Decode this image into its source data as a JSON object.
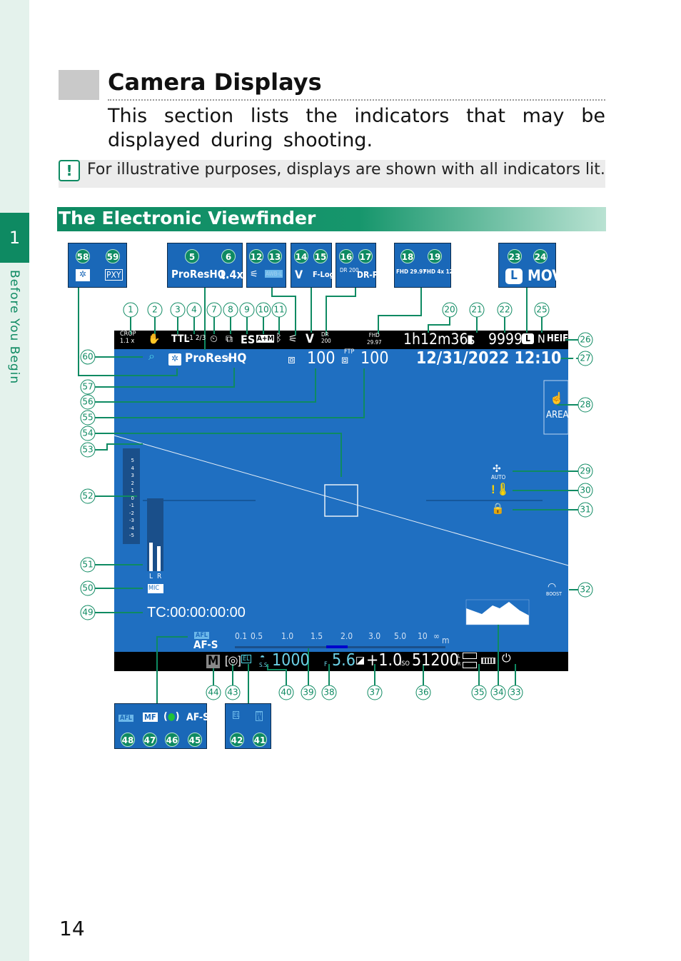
{
  "sidebar": {
    "chapter": "1",
    "label": "Before You Begin"
  },
  "page": {
    "title": "Camera Displays",
    "intro": "This section lists the indicators that may be displayed during shooting.",
    "note": "For illustrative purposes, displays are shown with all indicators lit.",
    "note_icon": "caution-icon",
    "section": "The Electronic Viewfinder",
    "number": "14"
  },
  "boxes": {
    "a": {
      "nums": [
        "58",
        "59"
      ],
      "items": [
        "shutter-icon",
        "PXY"
      ]
    },
    "b": {
      "nums": [
        "5",
        "6"
      ],
      "items": [
        "ProResHQ",
        "1.4x"
      ]
    },
    "c": {
      "nums": [
        "12",
        "13"
      ],
      "items": [
        "flicker-icon",
        "AWB-L"
      ]
    },
    "d": {
      "nums": [
        "14",
        "15"
      ],
      "items": [
        "V",
        "F-Log"
      ]
    },
    "e": {
      "nums": [
        "16",
        "17"
      ],
      "items": [
        "DR 200",
        "DR-P"
      ]
    },
    "f": {
      "nums": [
        "18",
        "19"
      ],
      "items": [
        "FHD 29.97",
        "FHD 4x 120"
      ]
    },
    "g": {
      "nums": [
        "23",
        "24"
      ],
      "items": [
        "L",
        "MOV"
      ]
    },
    "h": {
      "nums": [
        "48",
        "47",
        "46",
        "45"
      ],
      "items": [
        "AFL",
        "MF",
        "(●)",
        "AF-S"
      ]
    },
    "i": {
      "nums": [
        "42",
        "41"
      ],
      "items": [
        "EL",
        "TTL"
      ]
    }
  },
  "evf": {
    "top": {
      "crop": "CROP",
      "crop_val": "1.1 x",
      "ttl": "TTL",
      "comp": "-1 2/3",
      "es": "ES",
      "am": "A+M",
      "fhd": "FHD",
      "fps": "29.97",
      "time": "1h12m36s",
      "frames": "9999",
      "quality": "N",
      "format": "HEIF"
    },
    "row2": {
      "codec": "ProResHQ",
      "count1": "100",
      "ftp": "FTP",
      "count2": "100",
      "datetime": "12/31/2022 12:10  AM"
    },
    "area": "AREA",
    "auto": "AUTO",
    "boost": "BOOST",
    "exp_scale": [
      "5",
      "4",
      "3",
      "2",
      "1",
      "0",
      "-1",
      "-2",
      "-3",
      "-4",
      "-5"
    ],
    "mic": {
      "l": "L",
      "r": "R",
      "label": "MIC"
    },
    "timecode": "TC:00:00:00:00",
    "afl": "AFL",
    "afs": "AF-S",
    "distance": [
      "0.1",
      "0.5",
      "1.0",
      "1.5",
      "2.0",
      "3.0",
      "5.0",
      "10",
      "∞",
      "m"
    ],
    "bottom": {
      "mode": "M",
      "ss_label": "S.S.",
      "shutter": "1000",
      "f": "F",
      "aperture": "5.6",
      "ev": "+1.0",
      "iso_label": "ISO",
      "iso": "51200",
      "l": "L",
      "r": "R"
    }
  },
  "callouts": [
    "1",
    "2",
    "3",
    "4",
    "7",
    "8",
    "9",
    "10",
    "11",
    "20",
    "21",
    "22",
    "25",
    "26",
    "27",
    "28",
    "29",
    "30",
    "31",
    "32",
    "60",
    "57",
    "56",
    "55",
    "54",
    "53",
    "52",
    "51",
    "50",
    "49",
    "44",
    "43",
    "40",
    "39",
    "38",
    "37",
    "36",
    "35",
    "34",
    "33"
  ],
  "colors": {
    "accent": "#0e8a62",
    "screen": "#1f6fc1"
  }
}
